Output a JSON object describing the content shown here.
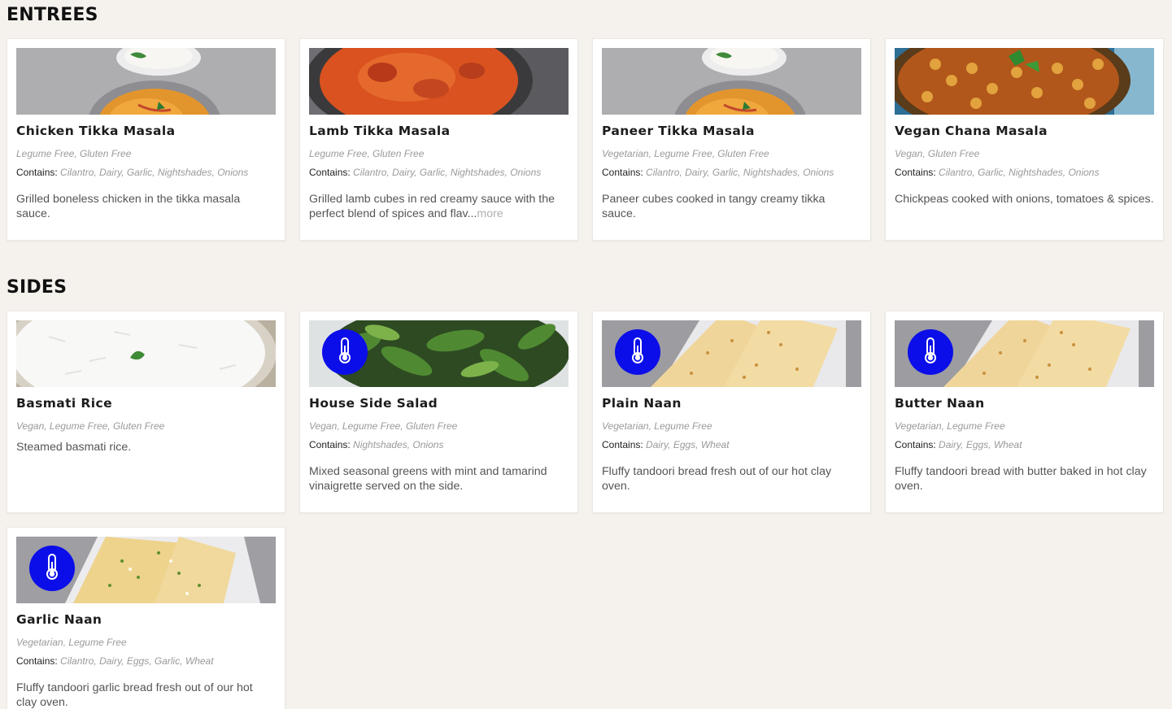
{
  "sections": [
    {
      "title": "ENTREES",
      "items": [
        {
          "name": "Chicken Tikka Masala",
          "diet": "Legume Free, Gluten Free",
          "contains_label": "Contains:",
          "contains": "Cilantro, Dairy, Garlic, Nightshades, Onions",
          "description": "Grilled boneless chicken in the tikka masala sauce.",
          "more": "",
          "image": "tikka-masala-rice-photo",
          "temp_icon": false
        },
        {
          "name": "Lamb Tikka Masala",
          "diet": "Legume Free, Gluten Free",
          "contains_label": "Contains:",
          "contains": "Cilantro, Dairy, Garlic, Nightshades, Onions",
          "description": "Grilled lamb cubes in red creamy sauce with the perfect blend of spices and flav...",
          "more": "more",
          "image": "red-curry-photo",
          "temp_icon": false
        },
        {
          "name": "Paneer Tikka Masala",
          "diet": "Vegetarian, Legume Free, Gluten Free",
          "contains_label": "Contains:",
          "contains": "Cilantro, Dairy, Garlic, Nightshades, Onions",
          "description": "Paneer cubes cooked in tangy creamy tikka sauce.",
          "more": "",
          "image": "tikka-masala-rice-photo",
          "temp_icon": false
        },
        {
          "name": "Vegan Chana Masala",
          "diet": "Vegan, Gluten Free",
          "contains_label": "Contains:",
          "contains": "Cilantro, Garlic, Nightshades, Onions",
          "description": "Chickpeas cooked with onions, tomatoes & spices.",
          "more": "",
          "image": "chickpea-curry-photo",
          "temp_icon": false
        }
      ]
    },
    {
      "title": "SIDES",
      "items": [
        {
          "name": "Basmati Rice",
          "diet": "Vegan, Legume Free, Gluten Free",
          "contains_label": "",
          "contains": "",
          "description": "Steamed basmati rice.",
          "more": "",
          "image": "rice-photo",
          "temp_icon": false
        },
        {
          "name": "House Side Salad",
          "diet": "Vegan, Legume Free, Gluten Free",
          "contains_label": "Contains:",
          "contains": "Nightshades, Onions",
          "description": "Mixed seasonal greens with mint and tamarind vinaigrette served on the side.",
          "more": "",
          "image": "salad-photo",
          "temp_icon": true
        },
        {
          "name": "Plain Naan",
          "diet": "Vegetarian, Legume Free",
          "contains_label": "Contains:",
          "contains": "Dairy, Eggs, Wheat",
          "description": "Fluffy tandoori bread fresh out of our hot clay oven.",
          "more": "",
          "image": "naan-photo",
          "temp_icon": true
        },
        {
          "name": "Butter Naan",
          "diet": "Vegetarian, Legume Free",
          "contains_label": "Contains:",
          "contains": "Dairy, Eggs, Wheat",
          "description": "Fluffy tandoori bread with butter baked in hot clay oven.",
          "more": "",
          "image": "naan-photo",
          "temp_icon": true
        },
        {
          "name": "Garlic Naan",
          "diet": "Vegetarian, Legume Free",
          "contains_label": "Contains:",
          "contains": "Cilantro, Dairy, Eggs, Garlic, Wheat",
          "description": "Fluffy tandoori garlic bread fresh out of our hot clay oven.",
          "more": "",
          "image": "garlic-naan-photo",
          "temp_icon": true
        }
      ]
    }
  ],
  "colors": {
    "page_background": "#f5f2ee",
    "card_background": "#ffffff",
    "temperature_badge": "#0b0ee8",
    "muted_text": "#9a9a9a"
  },
  "icons": {
    "temperature": "thermometer-icon"
  }
}
